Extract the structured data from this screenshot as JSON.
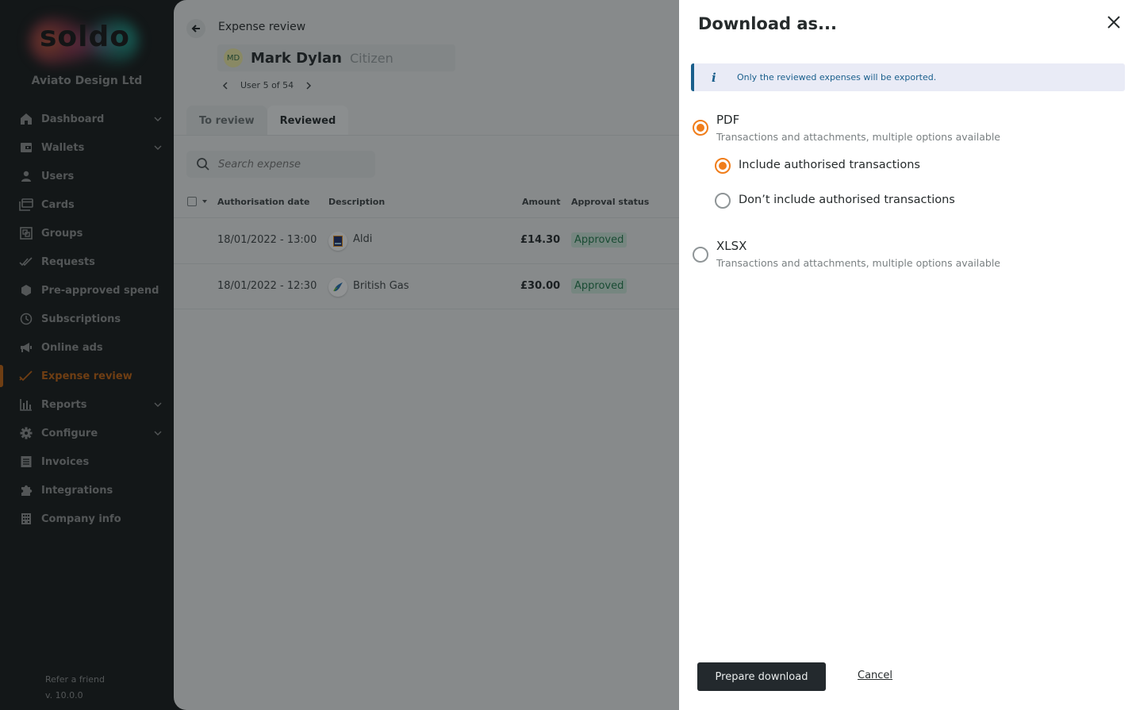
{
  "sidebar": {
    "logo": "soldo",
    "company": "Aviato Design Ltd",
    "items": [
      {
        "label": "Dashboard",
        "icon": "home-icon",
        "expandable": true
      },
      {
        "label": "Wallets",
        "icon": "wallet-icon",
        "expandable": true
      },
      {
        "label": "Users",
        "icon": "user-icon",
        "expandable": false
      },
      {
        "label": "Cards",
        "icon": "cards-icon",
        "expandable": false
      },
      {
        "label": "Groups",
        "icon": "groups-icon",
        "expandable": false
      },
      {
        "label": "Requests",
        "icon": "double-check-icon",
        "expandable": false
      },
      {
        "label": "Pre-approved spend",
        "icon": "hexagon-icon",
        "expandable": false
      },
      {
        "label": "Subscriptions",
        "icon": "clock-icon",
        "expandable": false
      },
      {
        "label": "Online ads",
        "icon": "megaphone-icon",
        "expandable": false
      },
      {
        "label": "Expense review",
        "icon": "check-icon",
        "expandable": false,
        "active": true
      },
      {
        "label": "Reports",
        "icon": "bar-chart-icon",
        "expandable": true
      },
      {
        "label": "Configure",
        "icon": "gear-icon",
        "expandable": true
      },
      {
        "label": "Invoices",
        "icon": "invoice-icon",
        "expandable": false
      },
      {
        "label": "Integrations",
        "icon": "puzzle-icon",
        "expandable": false
      },
      {
        "label": "Company info",
        "icon": "building-icon",
        "expandable": false
      }
    ],
    "refer": "Refer a friend",
    "version": "v. 10.0.0"
  },
  "main": {
    "breadcrumb": "Expense review",
    "user": {
      "initials": "MD",
      "name": "Mark Dylan",
      "role": "Citizen"
    },
    "pager": "User 5 of 54",
    "tabs": [
      {
        "label": "To review"
      },
      {
        "label": "Reviewed",
        "active": true
      }
    ],
    "search_placeholder": "Search expense",
    "columns": {
      "date": "Authorisation date",
      "description": "Description",
      "amount": "Amount",
      "status": "Approval status"
    },
    "rows": [
      {
        "date": "18/01/2022 - 13:00",
        "merchant": "Aldi",
        "amount": "£14.30",
        "status": "Approved"
      },
      {
        "date": "18/01/2022 - 12:30",
        "merchant": "British Gas",
        "amount": "£30.00",
        "status": "Approved"
      }
    ]
  },
  "drawer": {
    "title": "Download as...",
    "info": "Only the reviewed expenses will be exported.",
    "options": [
      {
        "title": "PDF",
        "desc": "Transactions and attachments, multiple options available",
        "selected": true
      },
      {
        "title": "XLSX",
        "desc": "Transactions and attachments, multiple options available",
        "selected": false
      }
    ],
    "sub_options": [
      {
        "label": "Include authorised transactions",
        "selected": true
      },
      {
        "label": "Don’t include authorised transactions",
        "selected": false
      }
    ],
    "primary_label": "Prepare download",
    "cancel_label": "Cancel"
  },
  "colors": {
    "accent": "#f07d1a",
    "active_nav": "#c1610f",
    "info": "#1a5f8c",
    "sidebar_bg": "#131717"
  }
}
